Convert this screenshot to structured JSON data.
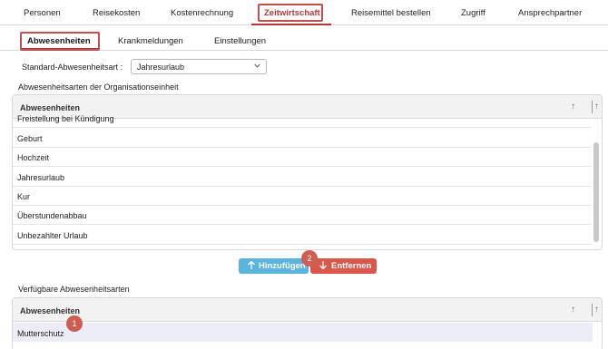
{
  "top_tabs": [
    "Personen",
    "Reisekosten",
    "Kostenrechnung",
    "Zeitwirtschaft",
    "Reisemittel bestellen",
    "Zugriff",
    "Ansprechpartner"
  ],
  "sub_tabs": [
    "Abwesenheiten",
    "Krankmeldungen",
    "Einstellungen"
  ],
  "standard": {
    "label": "Standard-Abwesenheitsart :",
    "value": "Jahresurlaub"
  },
  "org_section": {
    "title": "Abwesenheitsarten der Organisationseinheit",
    "header": "Abwesenheiten",
    "rows": [
      "Freistellung bei Kündigung",
      "Geburt",
      "Hochzeit",
      "Jahresurlaub",
      "Kur",
      "Überstundenabbau",
      "Unbezahlter Urlaub"
    ]
  },
  "buttons": {
    "add": "Hinzufügen",
    "remove": "Entfernen"
  },
  "available_section": {
    "title": "Verfügbare Abwesenheitsarten",
    "header": "Abwesenheiten",
    "rows": [
      "Mutterschutz"
    ]
  },
  "badges": [
    "1",
    "2"
  ],
  "icons": {
    "sort_up": "↑",
    "add": "arrow-up-icon",
    "remove": "arrow-down-icon",
    "chevron": "chevron-down-icon"
  },
  "colors": {
    "accent": "#b03a3a",
    "add_button": "#5ab4dd",
    "remove_button": "#d9574b",
    "badge": "#cf5e52",
    "selected_row": "#ecedf6"
  }
}
